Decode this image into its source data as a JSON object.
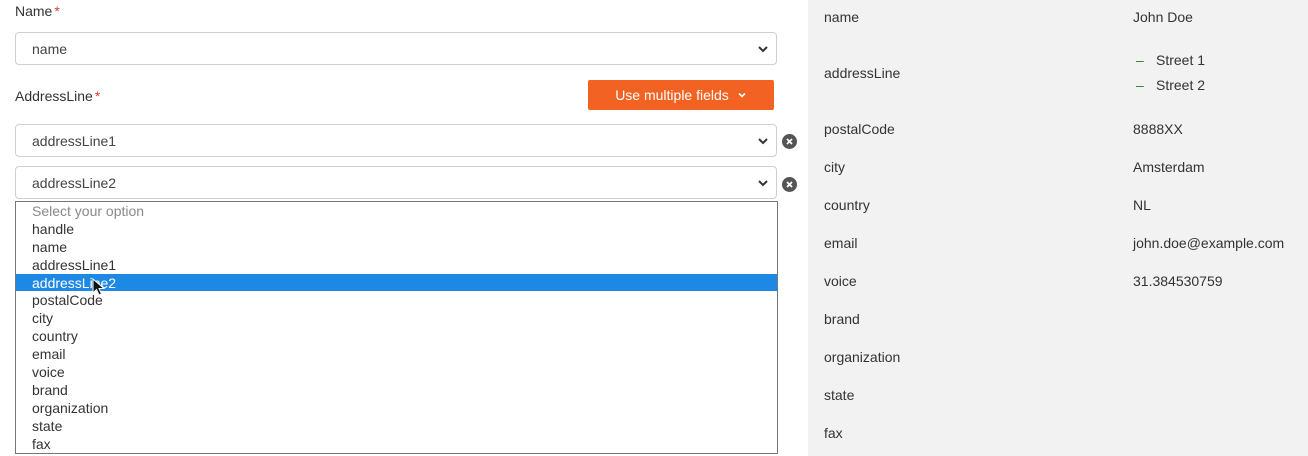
{
  "form": {
    "name_label": "Name",
    "required_mark": "*",
    "name_select_value": "name",
    "address_label": "AddressLine",
    "multi_button_label": "Use multiple fields",
    "address_line1_value": "addressLine1",
    "address_line2_value": "addressLine2",
    "dropdown": {
      "placeholder": "Select your option",
      "options": [
        "handle",
        "name",
        "addressLine1",
        "addressLine2",
        "postalCode",
        "city",
        "country",
        "email",
        "voice",
        "brand",
        "organization",
        "state",
        "fax"
      ],
      "selected": "addressLine2"
    }
  },
  "preview": {
    "rows": [
      {
        "key": "name",
        "value": "John Doe"
      },
      {
        "key": "addressLine",
        "value": ""
      },
      {
        "key": "postalCode",
        "value": "8888XX"
      },
      {
        "key": "city",
        "value": "Amsterdam"
      },
      {
        "key": "country",
        "value": "NL"
      },
      {
        "key": "email",
        "value": "john.doe@example.com"
      },
      {
        "key": "voice",
        "value": "31.384530759"
      },
      {
        "key": "brand",
        "value": ""
      },
      {
        "key": "organization",
        "value": ""
      },
      {
        "key": "state",
        "value": ""
      },
      {
        "key": "fax",
        "value": ""
      }
    ],
    "address_lines": [
      "Street 1",
      "Street 2"
    ],
    "bullet": "–"
  },
  "colors": {
    "accent_button": "#f26222",
    "highlight": "#1e88e5",
    "required": "#e03c31",
    "panel_bg": "#f2f2f2"
  },
  "icons": {
    "chevron": "chevron-down-icon",
    "remove": "close-circle-icon",
    "cursor": "mouse-pointer-icon"
  }
}
